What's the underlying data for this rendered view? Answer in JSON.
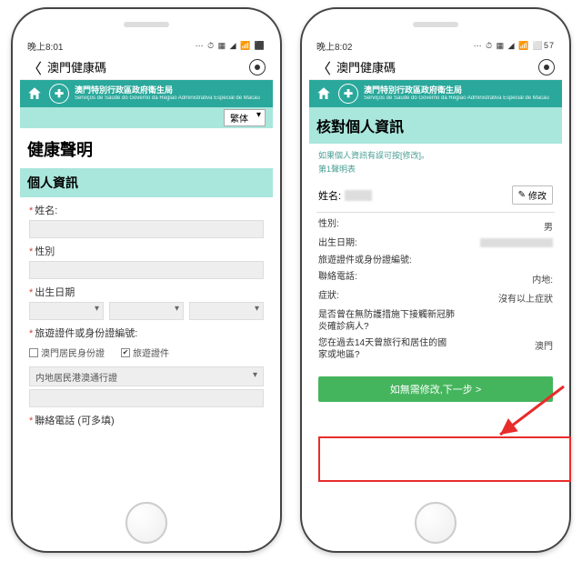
{
  "phoneA": {
    "status": {
      "time": "晚上8:01",
      "icons": "⋯ ⏱ ▦ ◢ 📶 ⬛"
    },
    "header": {
      "title": "澳門健康碼"
    },
    "gov_banner": {
      "badge": "✚",
      "line1": "澳門特別行政區政府衛生局",
      "line2": "Serviços de Saúde do Governo da Região Administrativa Especial de Macau"
    },
    "lang_selected": "繁体",
    "decl_title": "健康聲明",
    "section": "個人資訊",
    "labels": {
      "name": "姓名:",
      "gender": "性別",
      "dob": "出生日期",
      "doc": "旅遊證件或身份證編號:",
      "doc_sel": "内地居民港澳通行證",
      "checkbox_local": "澳門居民身份證",
      "checkbox_travel": "旅遊證件",
      "phone_multi": "聯絡電話 (可多填)"
    }
  },
  "phoneB": {
    "status": {
      "time": "晚上8:02",
      "icons": "⋯ ⏱ ▦ ◢ 📶 ⬜57"
    },
    "header": {
      "title": "澳門健康碼"
    },
    "gov_banner": {
      "badge": "✚",
      "line1": "澳門特別行政區政府衛生局",
      "line2": "Serviços de Saúde do Governo da Região Administrativa Especial de Macau"
    },
    "verify_title": "核對個人資訊",
    "hint1": "如果個人資訊有誤可按[修改]。",
    "hint2": "第1聲明表",
    "name_label": "姓名:",
    "edit_label": "修改",
    "rows": {
      "gender": {
        "label": "性別:",
        "val": "男"
      },
      "dob": {
        "label": "出生日期:"
      },
      "doc": {
        "label": "旅遊證件或身份證編號:"
      },
      "phone": {
        "label": "聯絡電話:",
        "val": "内地:"
      },
      "symptom": {
        "label": "症狀:",
        "val": "沒有以上症狀"
      },
      "contact": {
        "label": "是否曾在無防護措施下接觸新冠肺炎確診病人?"
      },
      "travel14": {
        "label": "您在過去14天曾旅行和居住的國家或地區?",
        "val": "澳門"
      }
    },
    "next_button": "如無需修改,下一步 >"
  }
}
